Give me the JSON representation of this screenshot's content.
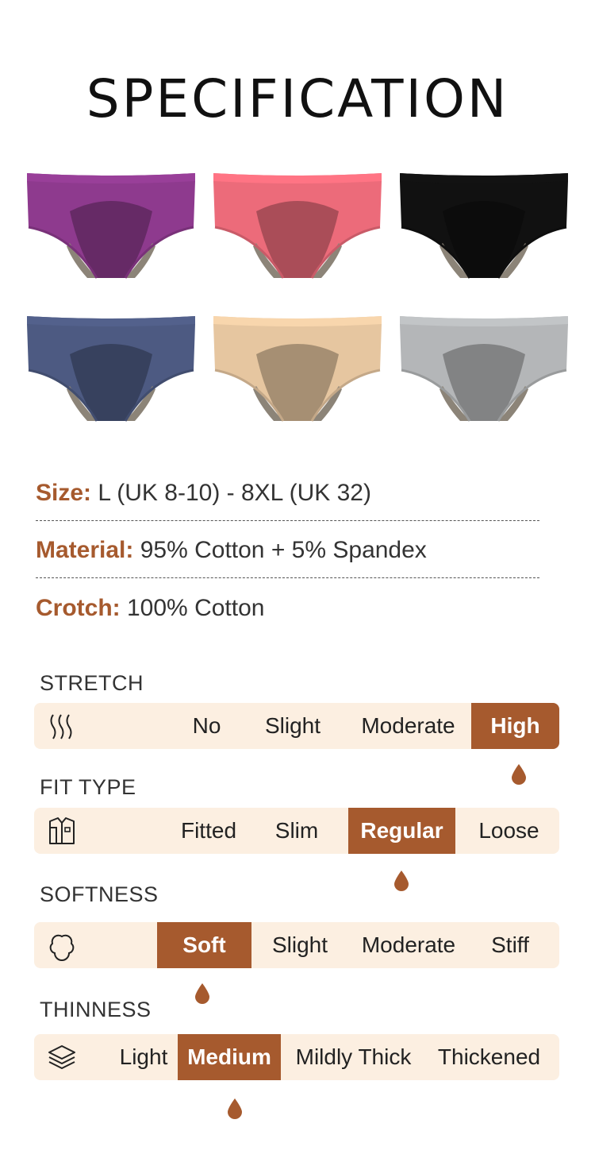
{
  "title": "SPECIFICATION",
  "colors": {
    "accent": "#a65a2e",
    "bar_bg": "#fcefe1",
    "swatches": [
      "#8e3a8e",
      "#ec6b7a",
      "#111111",
      "#4d5a82",
      "#e6c6a0",
      "#b4b6b8"
    ]
  },
  "specs": [
    {
      "key": "Size:",
      "value": "L (UK 8-10) - 8XL (UK 32)"
    },
    {
      "key": "Material:",
      "value": "95% Cotton + 5% Spandex"
    },
    {
      "key": "Crotch:",
      "value": "100% Cotton"
    }
  ],
  "sections": [
    {
      "label": "STRETCH",
      "icon": "stretch-waves-icon",
      "options": [
        "No",
        "Slight",
        "Moderate",
        "High"
      ],
      "selected": "High"
    },
    {
      "label": "FIT TYPE",
      "icon": "shirt-icon",
      "options": [
        "Fitted",
        "Slim",
        "Regular",
        "Loose"
      ],
      "selected": "Regular"
    },
    {
      "label": "SOFTNESS",
      "icon": "cotton-cloud-icon",
      "options": [
        "Soft",
        "Slight",
        "Moderate",
        "Stiff"
      ],
      "selected": "Soft"
    },
    {
      "label": "THINNESS",
      "icon": "layers-icon",
      "options": [
        "Light",
        "Medium",
        "Mildly Thick",
        "Thickened"
      ],
      "selected": "Medium"
    }
  ]
}
